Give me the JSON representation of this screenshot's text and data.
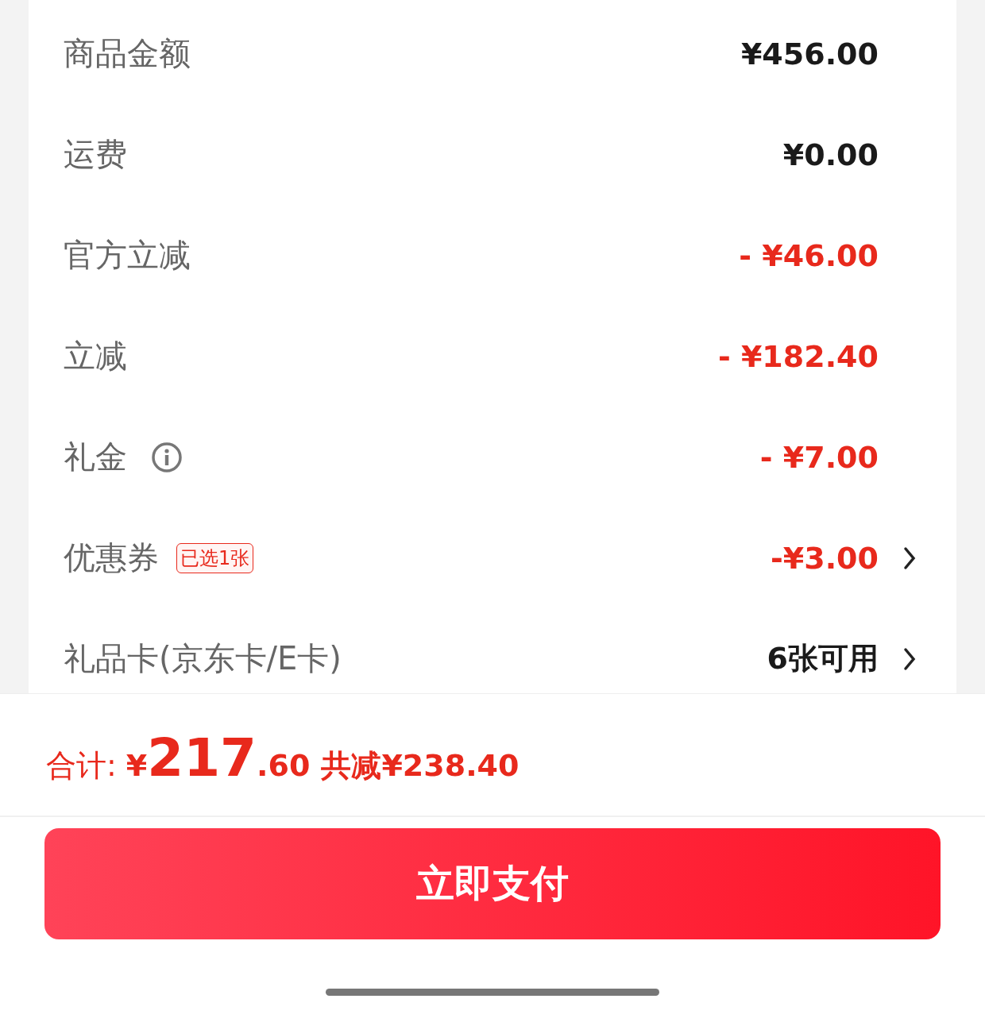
{
  "rows": [
    {
      "label": "商品金额",
      "value": "¥456.00",
      "kind": "price",
      "info": false,
      "chevron": false
    },
    {
      "label": "运费",
      "value": "¥0.00",
      "kind": "price",
      "info": false,
      "chevron": false
    },
    {
      "label": "官方立减",
      "value": "- ¥46.00",
      "kind": "discount",
      "info": false,
      "chevron": false
    },
    {
      "label": "立减",
      "value": "- ¥182.40",
      "kind": "discount",
      "info": false,
      "chevron": false
    },
    {
      "label": "礼金",
      "value": "- ¥7.00",
      "kind": "discount",
      "info": true,
      "chevron": false
    },
    {
      "label": "优惠券",
      "badge": "已选1张",
      "value": "-¥3.00",
      "kind": "discount",
      "info": false,
      "chevron": true
    },
    {
      "label": "礼品卡(京东卡/E卡)",
      "value": "6张可用",
      "kind": "price",
      "info": false,
      "chevron": true
    }
  ],
  "total": {
    "label": "合计:",
    "currency": "¥",
    "integer": "217",
    "decimal": ".60",
    "saved": "共减¥238.40"
  },
  "pay_button": "立即支付"
}
